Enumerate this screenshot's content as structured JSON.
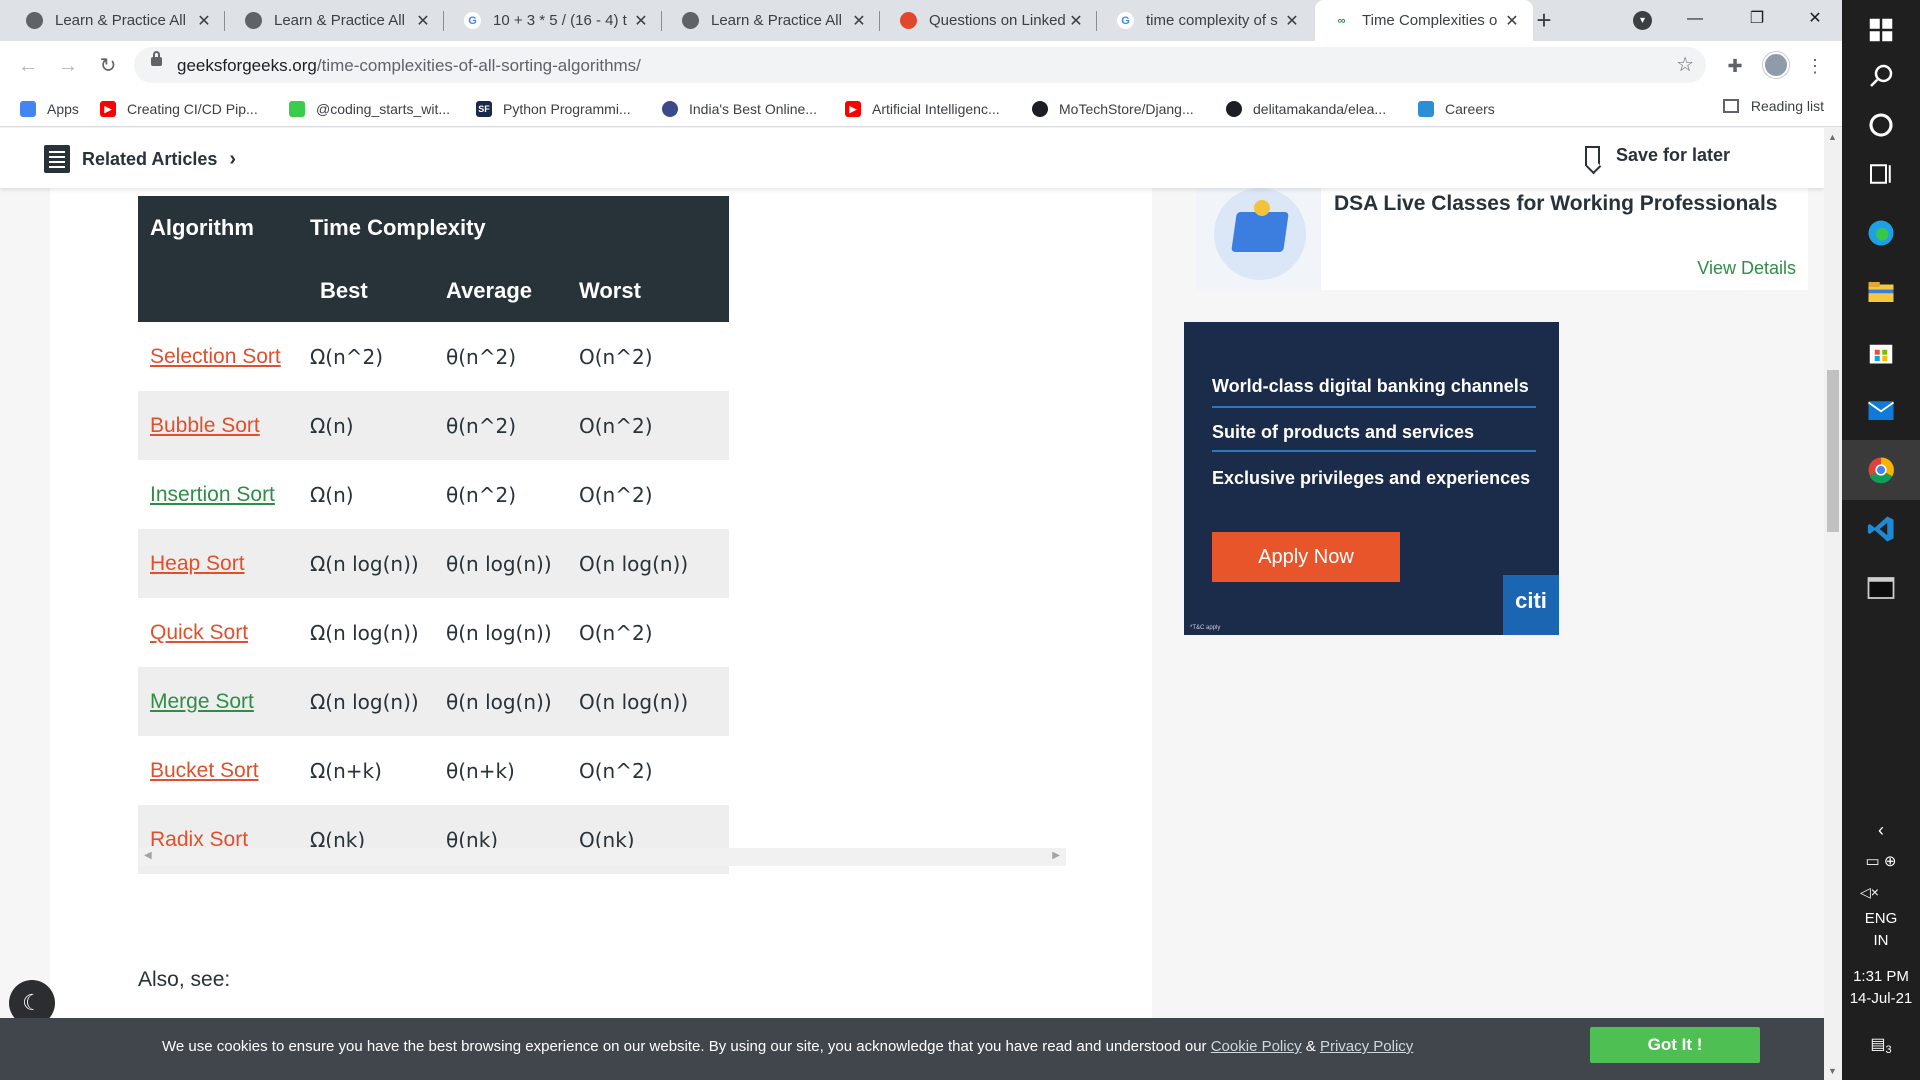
{
  "tabs": [
    {
      "title": "Learn & Practice All",
      "favicon": "globe-icon",
      "color": "#5f6368"
    },
    {
      "title": "Learn & Practice All",
      "favicon": "globe-icon",
      "color": "#5f6368"
    },
    {
      "title": "10 + 3 * 5 / (16 - 4) t",
      "favicon": "google-icon",
      "color": "#4285f4"
    },
    {
      "title": "Learn & Practice All",
      "favicon": "globe-icon",
      "color": "#5f6368"
    },
    {
      "title": "Questions on Linked",
      "favicon": "stack-icon",
      "color": "#e2462c"
    },
    {
      "title": "time complexity of s",
      "favicon": "google-icon",
      "color": "#4285f4"
    },
    {
      "title": "Time Complexities o",
      "favicon": "gfg-icon",
      "color": "#2f8d46"
    }
  ],
  "toolbar": {
    "url_host": "geeksforgeeks.org",
    "url_path": "/time-complexities-of-all-sorting-algorithms/"
  },
  "bookmarks": {
    "items": [
      {
        "label": "Apps",
        "icon": "apps-grid-icon",
        "color": "#4285f4"
      },
      {
        "label": "Creating CI/CD Pip...",
        "icon": "youtube-icon",
        "color": "#ff0000"
      },
      {
        "label": "@coding_starts_wit...",
        "icon": "leaf-icon",
        "color": "#3ccb4a"
      },
      {
        "label": "Python Programmi...",
        "icon": "sf-icon",
        "color": "#1b2a4a"
      },
      {
        "label": "India's Best Online...",
        "icon": "avatar-icon",
        "color": "#3c4a8a"
      },
      {
        "label": "Artificial Intelligenc...",
        "icon": "youtube-icon",
        "color": "#ff0000"
      },
      {
        "label": "MoTechStore/Djang...",
        "icon": "github-icon",
        "color": "#1b1f23"
      },
      {
        "label": "delitamakanda/elea...",
        "icon": "github-icon",
        "color": "#1b1f23"
      },
      {
        "label": "Careers",
        "icon": "cloud-icon",
        "color": "#2b8fd6"
      }
    ],
    "reading_list": "Reading list"
  },
  "sticky": {
    "related": "Related Articles",
    "save": "Save for later"
  },
  "table": {
    "header_algorithm": "Algorithm",
    "header_time_complexity": "Time Complexity",
    "header_best": "Best",
    "header_average": "Average",
    "header_worst": "Worst",
    "rows": [
      {
        "name": "Selection Sort",
        "link_color": "orange",
        "best": "Ω(n^2)",
        "average": "θ(n^2)",
        "worst": "O(n^2)"
      },
      {
        "name": "Bubble Sort",
        "link_color": "orange",
        "best": "Ω(n)",
        "average": "θ(n^2)",
        "worst": "O(n^2)"
      },
      {
        "name": "Insertion Sort",
        "link_color": "green",
        "best": "Ω(n)",
        "average": "θ(n^2)",
        "worst": "O(n^2)"
      },
      {
        "name": "Heap Sort",
        "link_color": "orange",
        "best": "Ω(n log(n))",
        "average": "θ(n log(n))",
        "worst": "O(n log(n))"
      },
      {
        "name": "Quick Sort",
        "link_color": "orange",
        "best": "Ω(n log(n))",
        "average": "θ(n log(n))",
        "worst": "O(n^2)"
      },
      {
        "name": "Merge Sort",
        "link_color": "green",
        "best": "Ω(n log(n))",
        "average": "θ(n log(n))",
        "worst": "O(n log(n))"
      },
      {
        "name": "Bucket Sort",
        "link_color": "orange",
        "best": "Ω(n+k)",
        "average": "θ(n+k)",
        "worst": "O(n^2)"
      },
      {
        "name": "Radix Sort",
        "link_color": "orange",
        "best": "Ω(nk)",
        "average": "θ(nk)",
        "worst": "O(nk)"
      }
    ]
  },
  "also_see": "Also, see:",
  "dsa_card": {
    "title": "DSA Live Classes for Working Professionals",
    "link": "View Details"
  },
  "ad": {
    "line1": "World-class digital banking channels",
    "line2": "Suite of products and services",
    "line3": "Exclusive privileges and experiences",
    "cta": "Apply Now",
    "brand": "citi",
    "fineprint": "*T&C apply"
  },
  "cookie": {
    "message": "We use cookies to ensure you have the best browsing experience on our website. By using our site, you acknowledge that you have read and understood our ",
    "cookie_policy": "Cookie Policy",
    "amp": " & ",
    "privacy_policy": "Privacy Policy",
    "button": "Got It !"
  },
  "system_tray": {
    "lang1": "ENG",
    "lang2": "IN",
    "time": "1:31 PM",
    "date": "14-Jul-21",
    "notifications": "3"
  },
  "colors": {
    "gfg_green": "#2f8d46",
    "link_orange": "#e1502b",
    "table_header": "#273239",
    "cookie_button": "#4ec053"
  }
}
